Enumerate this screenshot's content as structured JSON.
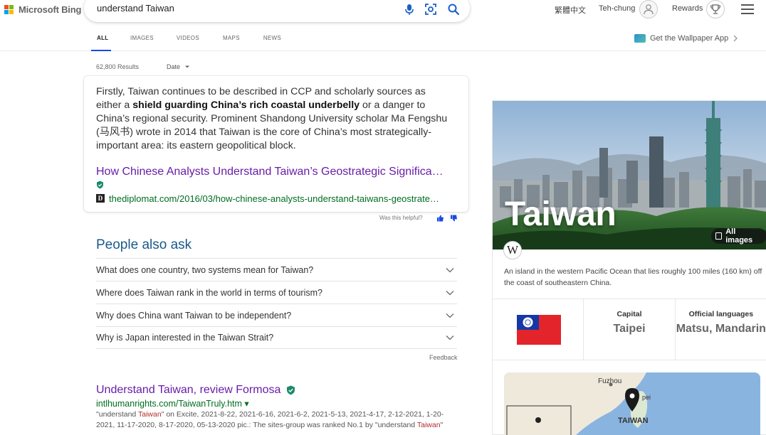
{
  "header": {
    "logo_text": "Microsoft Bing",
    "search_query": "understand Taiwan",
    "lang_label": "繁體中文",
    "user_name": "Teh-chung",
    "rewards_label": "Rewards",
    "wallpaper_label": "Get the Wallpaper App"
  },
  "tabs": [
    {
      "label": "ALL",
      "active": true
    },
    {
      "label": "IMAGES"
    },
    {
      "label": "VIDEOS"
    },
    {
      "label": "MAPS"
    },
    {
      "label": "NEWS"
    }
  ],
  "results": {
    "count": "62,800 Results",
    "date_filter": "Date"
  },
  "answer": {
    "text_before": "Firstly, Taiwan continues to be described in CCP and scholarly sources as either a ",
    "text_bold": "shield guarding China’s rich coastal underbelly",
    "text_after": " or a danger to China’s regional security. Prominent Shandong University scholar Ma Fengshu (马风书) wrote in 2014 that Taiwan is the core of China’s most strategically-important area: its eastern geopolitical block.",
    "link_title": "How Chinese Analysts Understand Taiwan’s Geostrategic Significa…",
    "favicon_letter": "D",
    "url": "thediplomat.com/2016/03/how-chinese-analysts-understand-taiwans-geostrate…",
    "helpful_label": "Was this helpful?"
  },
  "people_also_ask": {
    "title": "People also ask",
    "questions": [
      "What does one country, two systems mean for Taiwan?",
      "Where does Taiwan rank in the world in terms of tourism?",
      "Why does China want Taiwan to be independent?",
      "Why is Japan interested in the Taiwan Strait?"
    ],
    "feedback": "Feedback"
  },
  "result2": {
    "title": "Understand Taiwan, review Formosa",
    "url": "intlhumanrights.com/TaiwanTruly.htm ▾",
    "snippet_1": "\"understand ",
    "snippet_hl1": "Taiwan",
    "snippet_2": "\" on Excite, 2021-8-22, 2021-6-16, 2021-6-2, 2021-5-13, 2021-4-17, 2-12-2021, 1-20-2021, 11-17-2020, 8-17-2020, 05-13-2020 pic.: The sites-group was ranked No.1 by \"understand ",
    "snippet_hl2": "Taiwan",
    "snippet_3": "\" "
  },
  "knowledge_panel": {
    "name": "Taiwan",
    "all_images": "All images",
    "wiki_letter": "W",
    "description": "An island in the western Pacific Ocean that lies roughly 100 miles (160 km) off the coast of southeastern China.",
    "facts": [
      {
        "label": "Capital",
        "value": "Taipei"
      },
      {
        "label": "Official languages",
        "value": "Matsu, Mandarin"
      }
    ],
    "map": {
      "label_fuzhou": "Fuzhou",
      "label_taipei": "pei",
      "label_taiwan": "TAIWAN"
    }
  },
  "colors": {
    "accent": "#174ae4",
    "link_visited": "#681da8",
    "url_green": "#006d21"
  }
}
